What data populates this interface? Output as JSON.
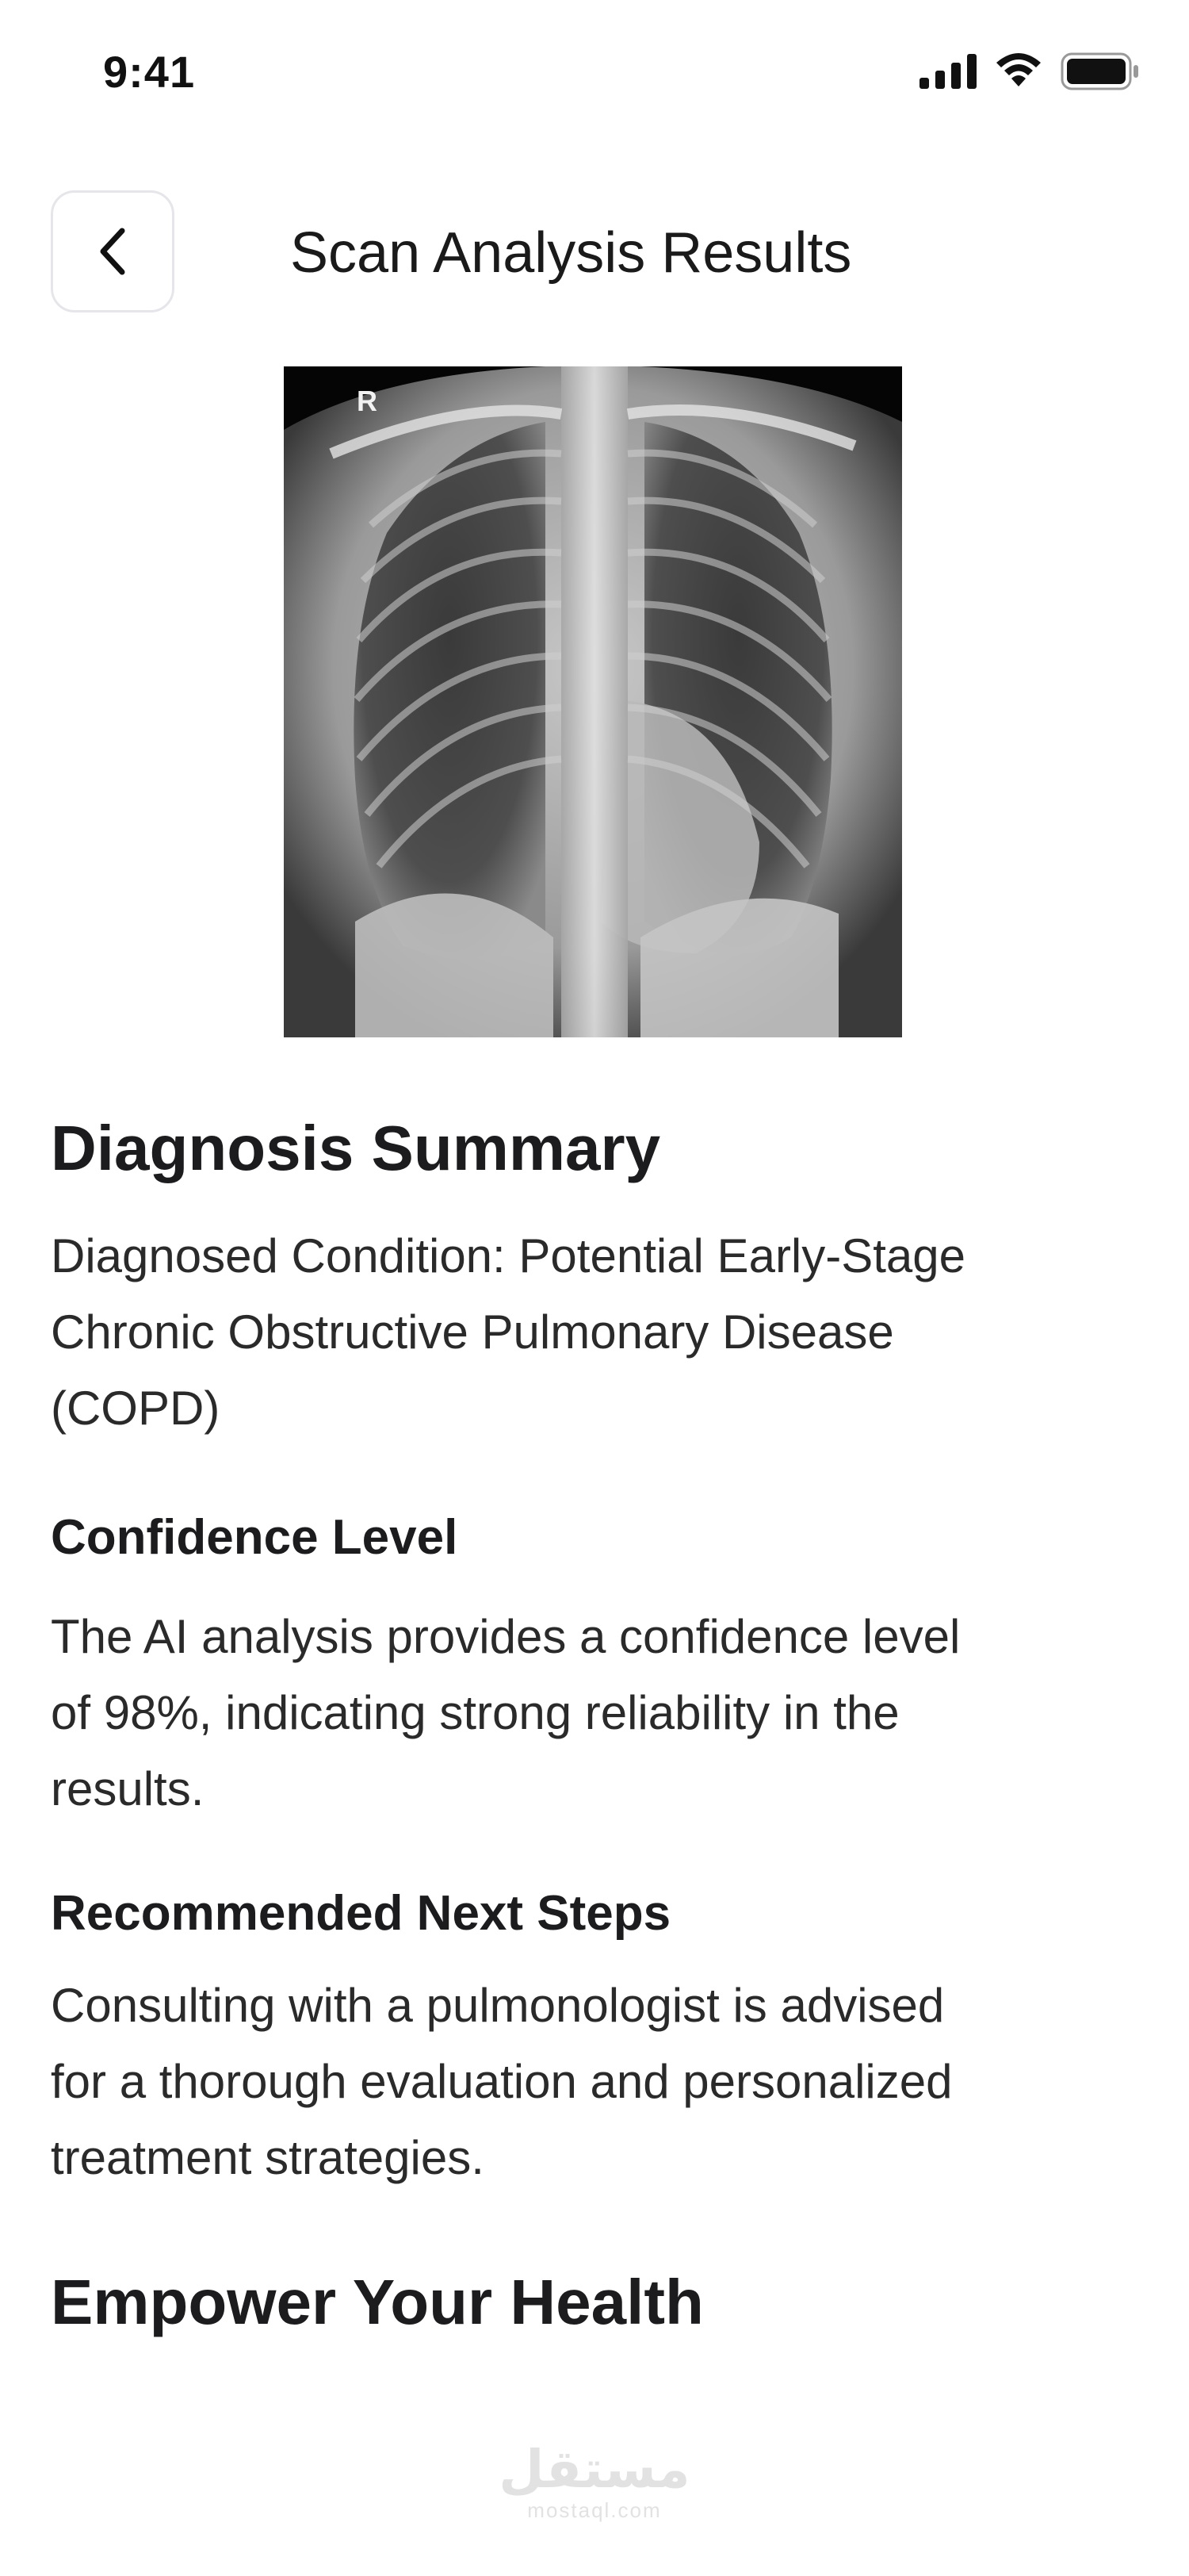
{
  "status_bar": {
    "time": "9:41",
    "icons": [
      "signal-icon",
      "wifi-icon",
      "battery-icon"
    ]
  },
  "header": {
    "back_icon": "chevron-left-icon",
    "title": "Scan Analysis Results"
  },
  "scan_image": {
    "marker": "R"
  },
  "diagnosis": {
    "heading": "Diagnosis Summary",
    "condition_lines": [
      "Diagnosed Condition: Potential Early-Stage",
      "Chronic Obstructive Pulmonary Disease",
      "(COPD)"
    ]
  },
  "confidence": {
    "heading": "Confidence Level",
    "lines": [
      "The AI analysis provides a confidence level",
      "of 98%, indicating strong reliability in the",
      "results."
    ]
  },
  "next_steps": {
    "heading": "Recommended Next Steps",
    "lines": [
      "Consulting with a pulmonologist is advised",
      "for a thorough evaluation and personalized",
      "treatment strategies."
    ]
  },
  "empower": {
    "heading": "Empower Your Health"
  },
  "watermark": {
    "arabic": "مستقل",
    "latin": "mostaql.com"
  },
  "colors": {
    "text": "#1c1c1e",
    "border": "#e6e6ea",
    "background": "#ffffff"
  }
}
